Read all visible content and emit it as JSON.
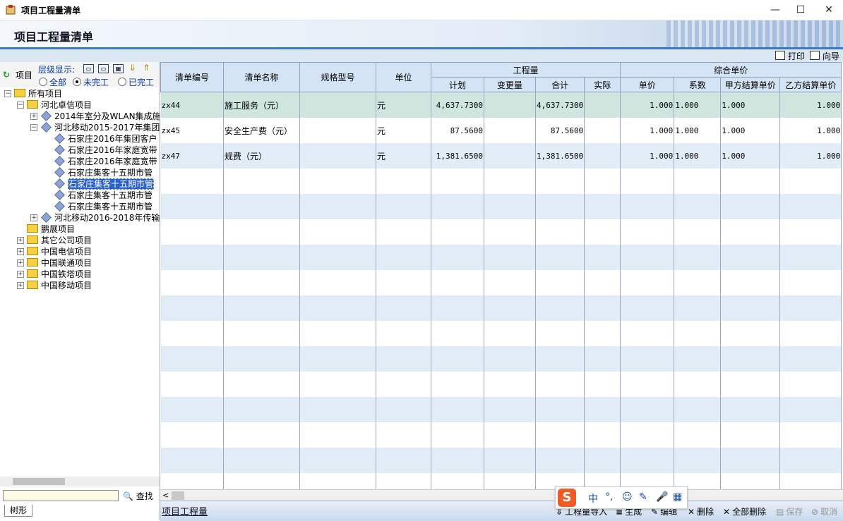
{
  "window": {
    "title": "项目工程量清单",
    "minimize": "—",
    "maximize": "☐",
    "close": "✕"
  },
  "header": {
    "title": "项目工程量清单"
  },
  "toolbar": {
    "print": "打印",
    "wizard": "向导"
  },
  "left_panel": {
    "title": "项目",
    "level_label": "层级显示:",
    "filters": [
      {
        "label": "全部",
        "selected": false
      },
      {
        "label": "未完工",
        "selected": true
      },
      {
        "label": "已完工",
        "selected": false
      }
    ],
    "tree": [
      {
        "label": "所有项目"
      },
      {
        "label": "河北卓信项目"
      },
      {
        "label": "2014年室分及WLAN集成施"
      },
      {
        "label": "河北移动2015-2017年集团"
      },
      {
        "label": "石家庄2016年集团客户"
      },
      {
        "label": "石家庄2016年家庭宽带"
      },
      {
        "label": "石家庄2016年家庭宽带"
      },
      {
        "label": "石家庄集客十五期市管"
      },
      {
        "label": "石家庄集客十五期市管"
      },
      {
        "label": "石家庄集客十五期市管"
      },
      {
        "label": "石家庄集客十五期市管"
      },
      {
        "label": "河北移动2016-2018年传输"
      },
      {
        "label": "鹏展项目"
      },
      {
        "label": "其它公司项目"
      },
      {
        "label": "中国电信项目"
      },
      {
        "label": "中国联通项目"
      },
      {
        "label": "中国铁塔项目"
      },
      {
        "label": "中国移动项目"
      }
    ],
    "search_value": "",
    "search_button": "查找",
    "tab": "树形"
  },
  "grid": {
    "headers": {
      "code": "清单编号",
      "name": "清单名称",
      "spec": "规格型号",
      "unit": "单位",
      "quantity": "工程量",
      "plan": "计划",
      "change": "变更量",
      "total": "合计",
      "actual": "实际",
      "price": "综合单价",
      "unit_price": "单价",
      "coef": "系数",
      "a_price": "甲方结算单价",
      "b_price": "乙方结算单价"
    },
    "rows": [
      {
        "code": "zx44",
        "name": "施工服务（元）",
        "spec": "",
        "unit": "元",
        "plan": "4,637.7300",
        "change": "",
        "total": "4,637.7300",
        "actual": "",
        "unit_price": "1.000",
        "coef": "1.000",
        "a_price": "1.000",
        "b_price": "1.000"
      },
      {
        "code": "zx45",
        "name": "安全生产费（元）",
        "spec": "",
        "unit": "元",
        "plan": "87.5600",
        "change": "",
        "total": "87.5600",
        "actual": "",
        "unit_price": "1.000",
        "coef": "1.000",
        "a_price": "1.000",
        "b_price": "1.000"
      },
      {
        "code": "zx47",
        "name": "规费（元）",
        "spec": "",
        "unit": "元",
        "plan": "1,381.6500",
        "change": "",
        "total": "1,381.6500",
        "actual": "",
        "unit_price": "1.000",
        "coef": "1.000",
        "a_price": "1.000",
        "b_price": "1.000"
      }
    ]
  },
  "bottom_bar": {
    "label": "项目工程量",
    "buttons": {
      "import": "工程量导入",
      "generate": "生成",
      "edit": "编辑",
      "delete": "删除",
      "delete_all": "全部删除",
      "save": "保存",
      "cancel": "取消"
    }
  },
  "ime": {
    "logo": "S",
    "lang": "中",
    "punct": "°,",
    "emoji": "☺",
    "brush": "✎",
    "mic": "🎤",
    "grid": "▦"
  }
}
